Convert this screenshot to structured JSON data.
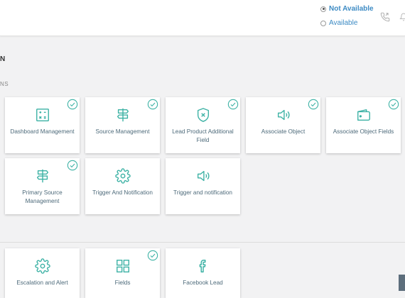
{
  "header": {
    "status_not_available": "Not Available",
    "status_available": "Available",
    "selected_status": "Not Available"
  },
  "section": {
    "title": "N",
    "subtitle": "NS"
  },
  "colors": {
    "accent": "#3bb1a4",
    "link": "#3d8bc4"
  },
  "cards_row1": [
    {
      "label": "Dashboard Management",
      "icon": "calculator-icon",
      "checked": true
    },
    {
      "label": "Source Management",
      "icon": "signpost-icon",
      "checked": true
    },
    {
      "label": "Lead Product Additional Field",
      "icon": "shield-x-icon",
      "checked": true
    },
    {
      "label": "Associate Object",
      "icon": "speaker-icon",
      "checked": true
    },
    {
      "label": "Associate Object Fields",
      "icon": "wallet-icon",
      "checked": true
    }
  ],
  "cards_row2": [
    {
      "label": "Primary Source Management",
      "icon": "signpost-icon",
      "checked": true
    },
    {
      "label": "Trigger And Notification",
      "icon": "gear-icon",
      "checked": false
    },
    {
      "label": "Trigger and notification",
      "icon": "speaker-icon",
      "checked": false
    }
  ],
  "cards_row3": [
    {
      "label": "Escalation and Alert",
      "icon": "gear-icon",
      "checked": false
    },
    {
      "label": "Fields",
      "icon": "grid-icon",
      "checked": true
    },
    {
      "label": "Facebook Lead",
      "icon": "facebook-icon",
      "checked": false
    }
  ]
}
